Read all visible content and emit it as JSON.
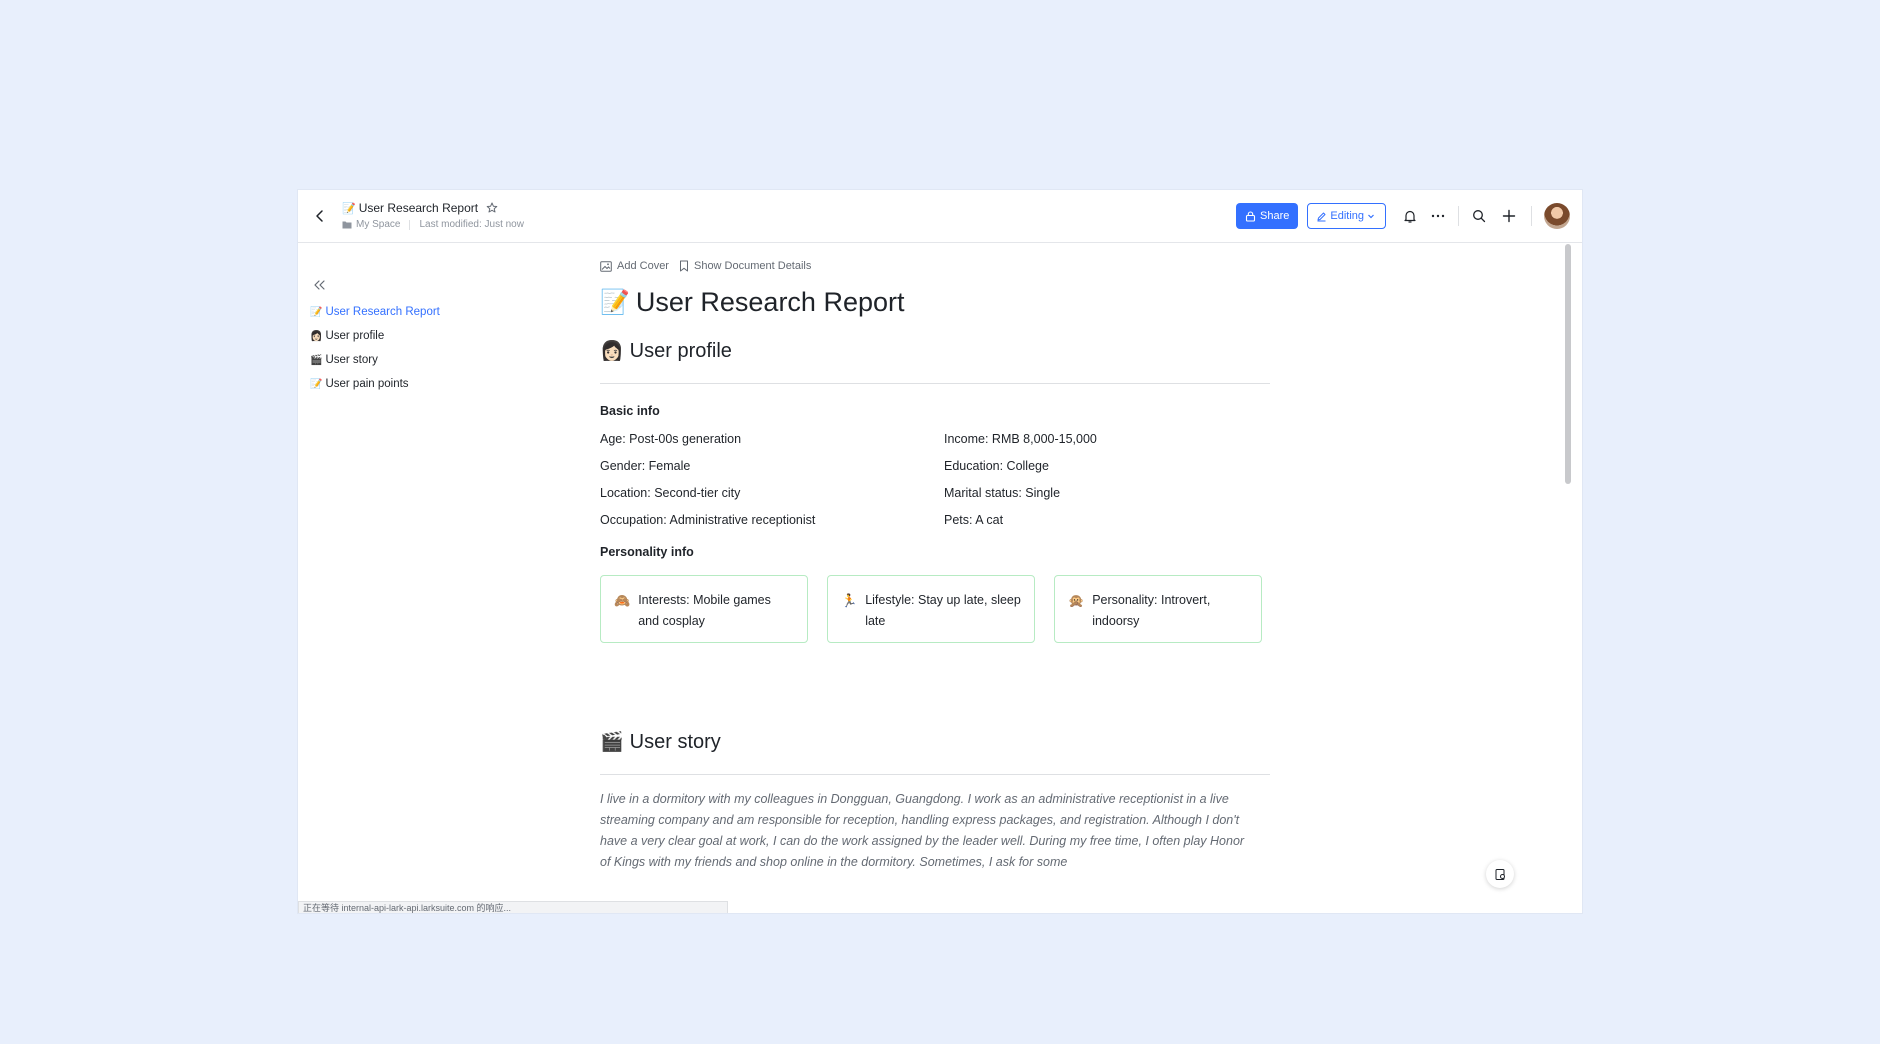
{
  "header": {
    "title_emoji": "📝",
    "title": "User Research Report",
    "breadcrumb": "My Space",
    "last_modified": "Last modified: Just now",
    "share_label": "Share",
    "mode_label": "Editing"
  },
  "toc": {
    "items": [
      {
        "emoji": "📝",
        "label": "User Research Report",
        "active": true
      },
      {
        "emoji": "👩🏻",
        "label": "User profile"
      },
      {
        "emoji": "🎬",
        "label": "User story"
      },
      {
        "emoji": "📝",
        "label": "User pain points"
      }
    ]
  },
  "doc": {
    "add_cover": "Add Cover",
    "show_details": "Show Document Details",
    "title_emoji": "📝",
    "title": "User Research Report",
    "profile": {
      "emoji": "👩🏻",
      "heading": "User profile",
      "basic_heading": "Basic info",
      "basic_left": [
        "Age: Post-00s generation",
        "Gender: Female",
        "Location: Second-tier city",
        "Occupation: Administrative receptionist"
      ],
      "basic_right": [
        "Income: RMB 8,000-15,000",
        "Education: College",
        "Marital status: Single",
        "Pets: A cat"
      ],
      "personality_heading": "Personality info",
      "cards": [
        {
          "emoji": "🙈",
          "text": "Interests: Mobile games and cosplay"
        },
        {
          "emoji": "🏃",
          "text": "Lifestyle: Stay up late, sleep late"
        },
        {
          "emoji": "🙊",
          "text": "Personality: Introvert, indoorsy"
        }
      ]
    },
    "story": {
      "emoji": "🎬",
      "heading": "User story",
      "text": "I live in a dormitory with my colleagues in Dongguan, Guangdong. I work as an administrative receptionist in a live streaming company and am responsible for reception, handling express packages, and registration. Although I don't have a very clear goal at work, I can do the work assigned by the leader well. During my free time, I often play Honor of Kings with my friends and shop online in the dormitory. Sometimes, I ask for some"
    }
  },
  "status_bar": "正在等待 internal-api-lark-api.larksuite.com 的响应...",
  "colors": {
    "accent": "#3370ff",
    "card_border": "#b7ebc3",
    "background": "#e8effc"
  }
}
